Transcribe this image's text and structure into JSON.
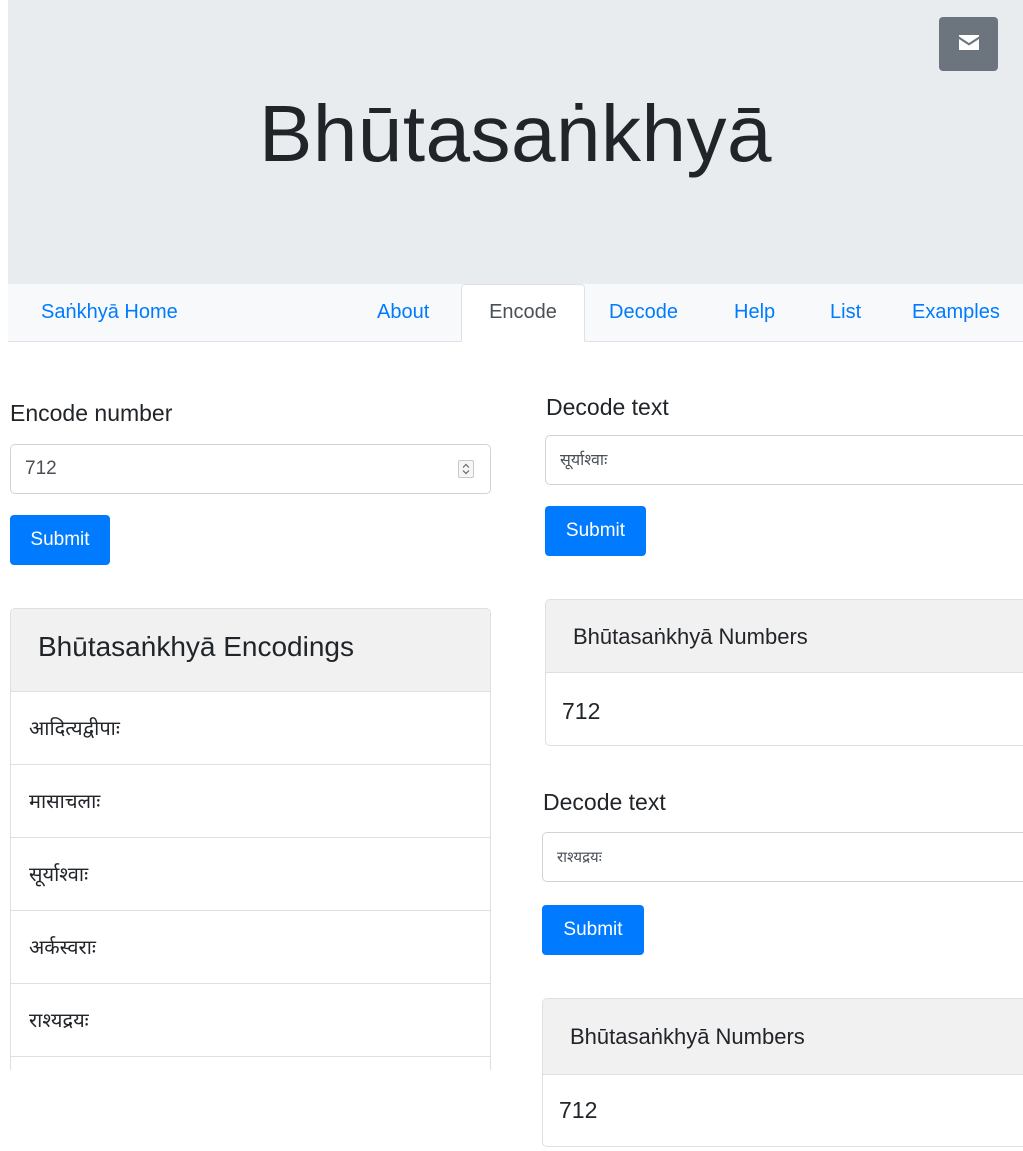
{
  "header": {
    "title": "Bhūtasaṅkhyā",
    "mail_icon": "envelope-icon"
  },
  "nav": {
    "brand": "Saṅkhyā Home",
    "items": [
      {
        "label": "About",
        "active": false
      },
      {
        "label": "Encode",
        "active": true
      },
      {
        "label": "Decode",
        "active": false
      },
      {
        "label": "Help",
        "active": false
      },
      {
        "label": "List",
        "active": false
      },
      {
        "label": "Examples",
        "active": false
      }
    ]
  },
  "encode": {
    "label": "Encode number",
    "value": "712",
    "submit_label": "Submit",
    "results_title": "Bhūtasaṅkhyā Encodings",
    "results": [
      "आदित्यद्वीपाः",
      "मासाचलाः",
      "सूर्याश्वाः",
      "अर्कस्वराः",
      "राश्यद्रयः"
    ]
  },
  "decode": [
    {
      "label": "Decode text",
      "value": "सूर्याश्वाः",
      "submit_label": "Submit",
      "results_title": "Bhūtasaṅkhyā Numbers",
      "result": "712"
    },
    {
      "label": "Decode text",
      "value": "राश्यद्रयः",
      "submit_label": "Submit",
      "results_title": "Bhūtasaṅkhyā Numbers",
      "result": "712"
    }
  ],
  "colors": {
    "primary": "#007bff",
    "jumbotron_bg": "#e9ecef",
    "nav_bg": "#f8f9fa",
    "mail_button": "#6c757d"
  }
}
